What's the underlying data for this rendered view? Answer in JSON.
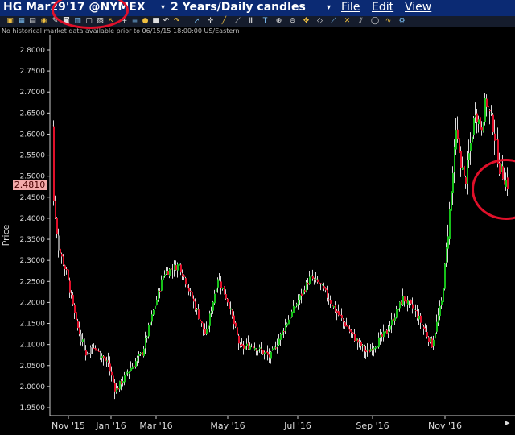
{
  "header": {
    "symbol": "HG Mar29'17 @NYMEX",
    "period": "2 Years/Daily candles",
    "menus": [
      "File",
      "Edit",
      "View"
    ]
  },
  "toolbar": {
    "icons": [
      "open-icon",
      "grid-icon",
      "candles-icon",
      "zoom-icon",
      "draw-icon",
      "camera-icon",
      "chart-icon",
      "tile-icon",
      "layout-icon",
      "cursor-icon",
      "plus-icon",
      "bars-icon",
      "circle-icon",
      "square-icon",
      "undo-icon",
      "redo-icon",
      "arrow-icon",
      "crosshair-icon",
      "line-icon",
      "ray-icon",
      "fib-icon",
      "text-icon",
      "zoom-in-icon",
      "zoom-out-icon",
      "pan-icon",
      "shapes-icon",
      "trend-icon",
      "cross-icon",
      "channel-icon",
      "ellipse-icon",
      "curve-icon",
      "settings-icon"
    ]
  },
  "notice": "No historical market data available prior to 06/15/15 18:00:00 US/Eastern",
  "last_price": "2.4810",
  "colors": {
    "up": "#17c21a",
    "down": "#e0102a",
    "neutral": "#8a8a8a",
    "annotation": "#e0102a",
    "title_bar": "#0b2a73"
  },
  "chart_data": {
    "type": "candlestick",
    "ylabel": "Price",
    "ylim": [
      1.94,
      2.82
    ],
    "yticks": [
      "2.8000",
      "2.7500",
      "2.7000",
      "2.6500",
      "2.6000",
      "2.5500",
      "2.5000",
      "2.4500",
      "2.4000",
      "2.3500",
      "2.3000",
      "2.2500",
      "2.2000",
      "2.1500",
      "2.1000",
      "2.0500",
      "2.0000",
      "1.9500"
    ],
    "xticks": [
      "Nov '15",
      "Jan '16",
      "Mar '16",
      "May '16",
      "Jul '16",
      "Sep '16",
      "Nov '16"
    ],
    "grid": false,
    "approx_close_path": [
      {
        "date": "Oct '15",
        "price": 2.62
      },
      {
        "date": "Oct '15",
        "price": 2.44
      },
      {
        "date": "Oct '15",
        "price": 2.33
      },
      {
        "date": "Nov '15",
        "price": 2.27
      },
      {
        "date": "Nov '15",
        "price": 2.15
      },
      {
        "date": "Dec '15",
        "price": 2.08
      },
      {
        "date": "Dec '15",
        "price": 2.1
      },
      {
        "date": "Jan '16",
        "price": 2.05
      },
      {
        "date": "Jan '16",
        "price": 1.99
      },
      {
        "date": "Feb '16",
        "price": 2.04
      },
      {
        "date": "Feb '16",
        "price": 2.08
      },
      {
        "date": "Mar '16",
        "price": 2.18
      },
      {
        "date": "Mar '16",
        "price": 2.27
      },
      {
        "date": "Mar '16",
        "price": 2.29
      },
      {
        "date": "Apr '16",
        "price": 2.2
      },
      {
        "date": "Apr '16",
        "price": 2.12
      },
      {
        "date": "May '16",
        "price": 2.26
      },
      {
        "date": "May '16",
        "price": 2.2
      },
      {
        "date": "Jun '16",
        "price": 2.09
      },
      {
        "date": "Jun '16",
        "price": 2.1
      },
      {
        "date": "Jul '16",
        "price": 2.07
      },
      {
        "date": "Jul '16",
        "price": 2.15
      },
      {
        "date": "Jul '16",
        "price": 2.26
      },
      {
        "date": "Aug '16",
        "price": 2.24
      },
      {
        "date": "Aug '16",
        "price": 2.17
      },
      {
        "date": "Sep '16",
        "price": 2.12
      },
      {
        "date": "Sep '16",
        "price": 2.08
      },
      {
        "date": "Oct '16",
        "price": 2.13
      },
      {
        "date": "Oct '16",
        "price": 2.21
      },
      {
        "date": "Oct '16",
        "price": 2.18
      },
      {
        "date": "Oct '16",
        "price": 2.1
      },
      {
        "date": "Nov '16",
        "price": 2.2
      },
      {
        "date": "Nov '16",
        "price": 2.37
      },
      {
        "date": "Nov '16",
        "price": 2.6
      },
      {
        "date": "Nov '16",
        "price": 2.48
      },
      {
        "date": "Dec '16",
        "price": 2.66
      },
      {
        "date": "Dec '16",
        "price": 2.61
      },
      {
        "date": "Dec '16",
        "price": 2.68
      },
      {
        "date": "Dec '16",
        "price": 2.62
      },
      {
        "date": "Jan '17",
        "price": 2.52
      },
      {
        "date": "Jan '17",
        "price": 2.48
      }
    ]
  }
}
